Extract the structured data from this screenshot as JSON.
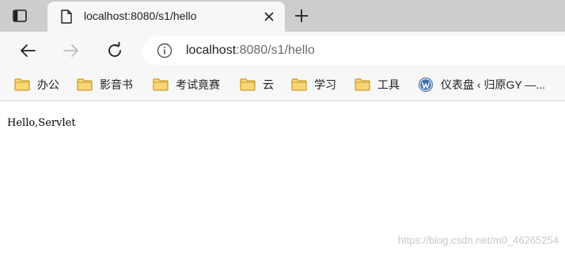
{
  "tab": {
    "title": "localhost:8080/s1/hello"
  },
  "address_bar": {
    "host": "localhost",
    "rest": ":8080/s1/hello"
  },
  "bookmarks": [
    {
      "label": "办公",
      "icon": "folder-icon"
    },
    {
      "label": "影音书",
      "icon": "folder-icon"
    },
    {
      "label": "考试竟赛",
      "icon": "folder-icon"
    },
    {
      "label": "云",
      "icon": "folder-icon"
    },
    {
      "label": "学习",
      "icon": "folder-icon"
    },
    {
      "label": "工具",
      "icon": "folder-icon"
    },
    {
      "label": "仪表盘 ‹ 归原GY —...",
      "icon": "wordpress-icon"
    }
  ],
  "page": {
    "body_text": "Hello,Servlet"
  },
  "watermark": "https://blog.csdn.net/m0_46265254",
  "colors": {
    "tabstrip": "#cdcdcd",
    "toolbar": "#f7f7f7",
    "folder_fill": "#f8d775",
    "folder_stroke": "#c99a2e"
  }
}
